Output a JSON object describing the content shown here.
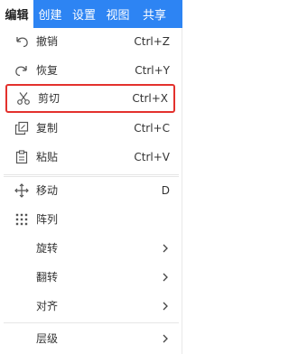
{
  "menubar": {
    "tabs": [
      {
        "label": "编辑",
        "active": true
      },
      {
        "label": "创建",
        "active": false
      },
      {
        "label": "设置",
        "active": false
      },
      {
        "label": "视图",
        "active": false
      },
      {
        "label": "共享",
        "active": false
      }
    ]
  },
  "menu": {
    "items": [
      {
        "label": "撤销",
        "shortcut": "Ctrl+Z",
        "icon": "undo-icon"
      },
      {
        "label": "恢复",
        "shortcut": "Ctrl+Y",
        "icon": "redo-icon"
      },
      {
        "label": "剪切",
        "shortcut": "Ctrl+X",
        "icon": "scissors-icon",
        "highlighted": true
      },
      {
        "label": "复制",
        "shortcut": "Ctrl+C",
        "icon": "copy-icon"
      },
      {
        "label": "粘贴",
        "shortcut": "Ctrl+V",
        "icon": "paste-icon"
      },
      {
        "label": "移动",
        "shortcut": "D",
        "icon": "move-icon"
      },
      {
        "label": "阵列",
        "shortcut": "",
        "icon": "array-icon"
      },
      {
        "label": "旋转",
        "submenu": true
      },
      {
        "label": "翻转",
        "submenu": true
      },
      {
        "label": "对齐",
        "submenu": true
      },
      {
        "label": "层级",
        "submenu": true
      }
    ]
  },
  "colors": {
    "menubar_bg": "#2d84f3",
    "highlight_border": "#e3312d",
    "icon": "#555555"
  }
}
